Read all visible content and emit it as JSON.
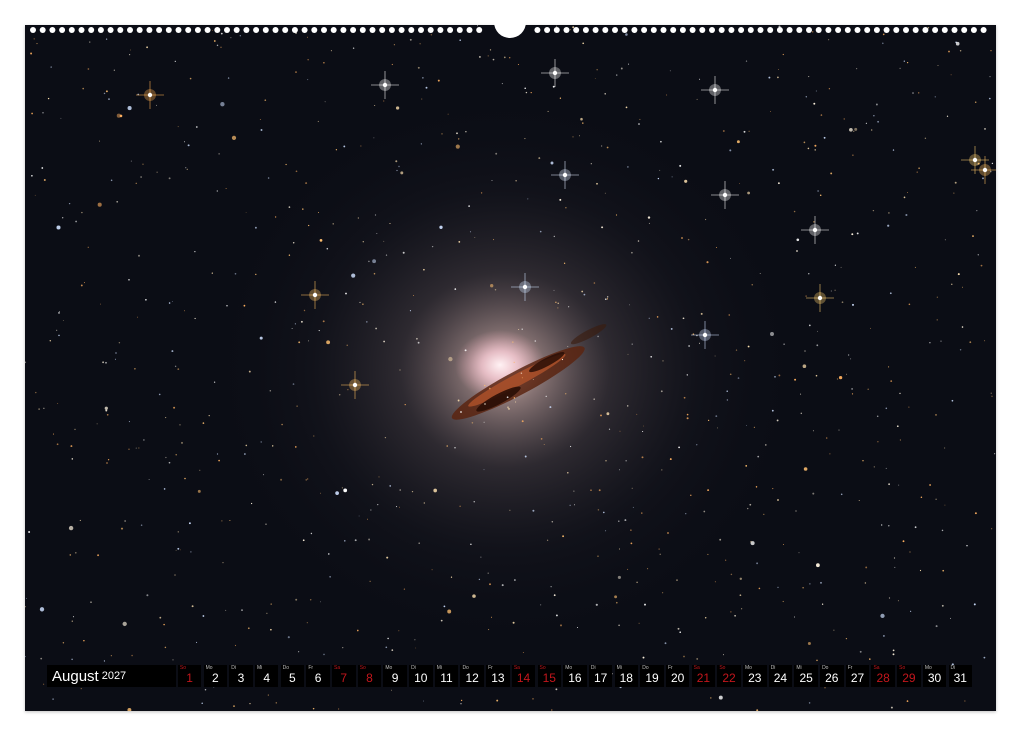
{
  "calendar": {
    "month": "August",
    "year": "2027",
    "days": [
      {
        "dow": "So",
        "num": "1",
        "weekend": true
      },
      {
        "dow": "Mo",
        "num": "2",
        "weekend": false
      },
      {
        "dow": "Di",
        "num": "3",
        "weekend": false
      },
      {
        "dow": "Mi",
        "num": "4",
        "weekend": false
      },
      {
        "dow": "Do",
        "num": "5",
        "weekend": false
      },
      {
        "dow": "Fr",
        "num": "6",
        "weekend": false
      },
      {
        "dow": "Sa",
        "num": "7",
        "weekend": true
      },
      {
        "dow": "So",
        "num": "8",
        "weekend": true
      },
      {
        "dow": "Mo",
        "num": "9",
        "weekend": false
      },
      {
        "dow": "Di",
        "num": "10",
        "weekend": false
      },
      {
        "dow": "Mi",
        "num": "11",
        "weekend": false
      },
      {
        "dow": "Do",
        "num": "12",
        "weekend": false
      },
      {
        "dow": "Fr",
        "num": "13",
        "weekend": false
      },
      {
        "dow": "Sa",
        "num": "14",
        "weekend": true
      },
      {
        "dow": "So",
        "num": "15",
        "weekend": true
      },
      {
        "dow": "Mo",
        "num": "16",
        "weekend": false
      },
      {
        "dow": "Di",
        "num": "17",
        "weekend": false
      },
      {
        "dow": "Mi",
        "num": "18",
        "weekend": false
      },
      {
        "dow": "Do",
        "num": "19",
        "weekend": false
      },
      {
        "dow": "Fr",
        "num": "20",
        "weekend": false
      },
      {
        "dow": "Sa",
        "num": "21",
        "weekend": true
      },
      {
        "dow": "So",
        "num": "22",
        "weekend": true
      },
      {
        "dow": "Mo",
        "num": "23",
        "weekend": false
      },
      {
        "dow": "Di",
        "num": "24",
        "weekend": false
      },
      {
        "dow": "Mi",
        "num": "25",
        "weekend": false
      },
      {
        "dow": "Do",
        "num": "26",
        "weekend": false
      },
      {
        "dow": "Fr",
        "num": "27",
        "weekend": false
      },
      {
        "dow": "Sa",
        "num": "28",
        "weekend": true
      },
      {
        "dow": "So",
        "num": "29",
        "weekend": true
      },
      {
        "dow": "Mo",
        "num": "30",
        "weekend": false
      },
      {
        "dow": "Di",
        "num": "31",
        "weekend": false
      }
    ]
  },
  "colors": {
    "sky": "#0b0d15",
    "weekend": "#c4161c",
    "calendar_bar": "#000000"
  }
}
